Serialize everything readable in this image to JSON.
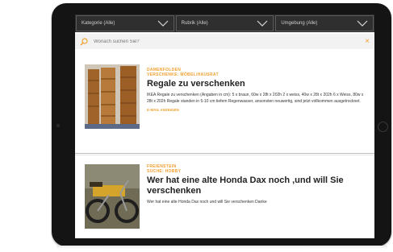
{
  "filters": {
    "category": "Kategorie (Alle)",
    "rubric": "Rubrik (Alle)",
    "area": "Umgebung (Alle)"
  },
  "search": {
    "placeholder": "Wonach suchen Sie?",
    "clear_icon": "×"
  },
  "listings": [
    {
      "location": "DAMENFOLDEN",
      "category": "VERSCHENKE: MÖBEL/HAUSRAT",
      "title": "Regale zu verschenken",
      "description": "IKEA Regale zu verschenken (Angaben in cm): 5 x braun, 60w x 28t x 202h 2 x weiss, 40w x 28t x 202h 6 x Weiss, 80w x 28t x 202h Regale standen in 5-10 cm tiefem Regenwasser, ansonsten neuwertig, sind jetzt vollkommen ausgetrocknet.",
      "link": "E-MAIL ANZEIGEN"
    },
    {
      "location": "FREIENSTEIN",
      "category": "SUCHE: HOBBY",
      "title": "Wer hat eine alte Honda Dax noch ,und will Sie verschenken",
      "description": "Wer hat eine alte Honda Dax noch und will Sie verschenken Danke"
    }
  ],
  "colors": {
    "accent": "#f0a030",
    "filter_bar": "#2f2f2f",
    "tablet": "#141414"
  }
}
